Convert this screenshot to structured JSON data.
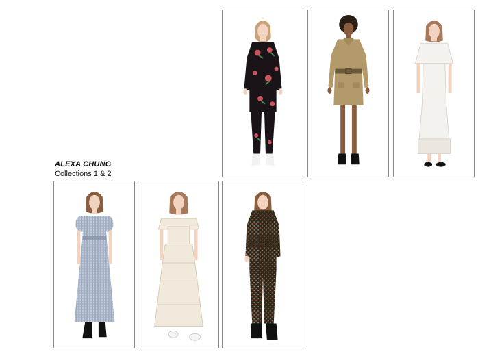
{
  "caption": {
    "title": "ALEXA CHUNG",
    "subtitle": "Collections 1 & 2"
  },
  "looks": [
    {
      "garment": "black-velvet-floral-tunic-and-trousers",
      "colors": {
        "main": "#1a1418",
        "accent": "#c8545e",
        "leaf": "#3f8a52"
      }
    },
    {
      "garment": "khaki-belted-shirt-dress",
      "colors": {
        "main": "#b39a6a",
        "accent": "#6b5a3a"
      }
    },
    {
      "garment": "white-caped-midi-dress",
      "colors": {
        "main": "#f4f2ee",
        "accent": "#d9d6d0"
      }
    },
    {
      "garment": "blue-gingham-maxi-dress",
      "colors": {
        "main": "#b7c1d2",
        "accent": "#7f8aa0"
      }
    },
    {
      "garment": "cream-tiered-ruffle-maxi-dress",
      "colors": {
        "main": "#f1eadc",
        "accent": "#d8ccb4"
      }
    },
    {
      "garment": "dark-floral-jumpsuit",
      "colors": {
        "main": "#2e2a20",
        "accent": "#b25a3a"
      }
    }
  ]
}
